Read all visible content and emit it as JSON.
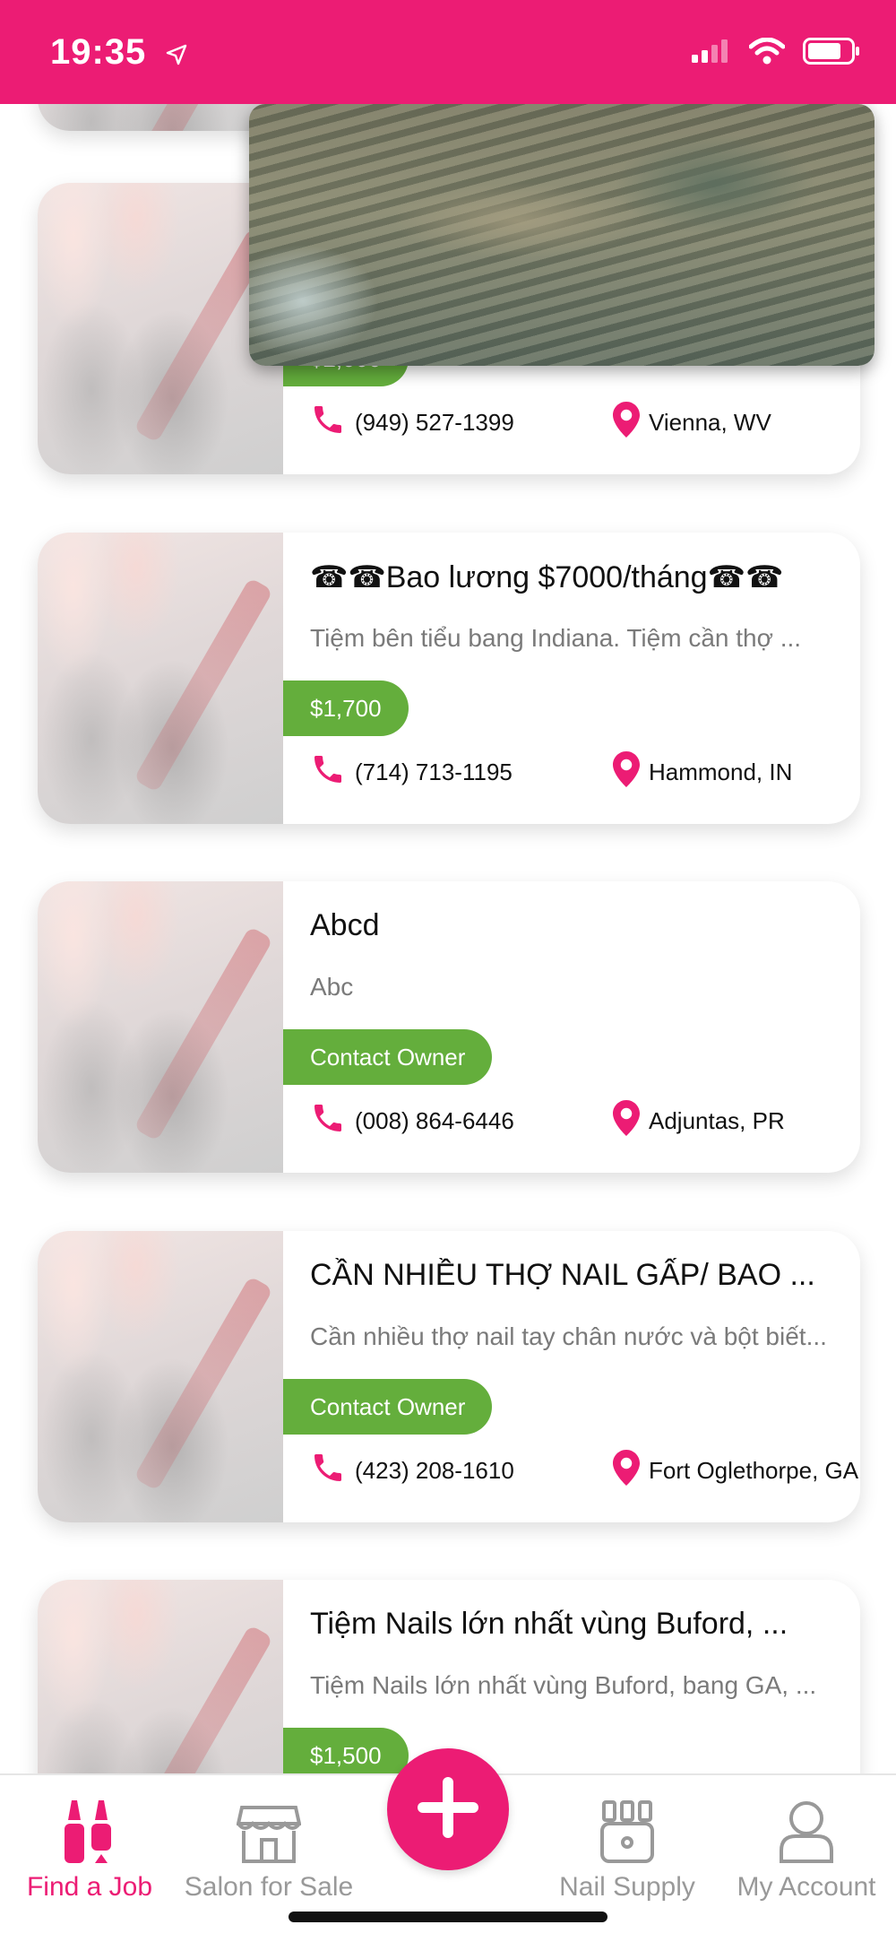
{
  "status_bar": {
    "time": "19:35"
  },
  "listings": [
    {
      "title": "",
      "description": "",
      "price": "$2,000",
      "phone": "(949) 527-1399",
      "location": "Vienna, WV"
    },
    {
      "title": "☎☎Bao lương $7000/tháng☎☎",
      "description": "Tiệm bên tiểu bang Indiana. Tiệm cần thợ ...",
      "price": "$1,700",
      "phone": "(714) 713-1195",
      "location": "Hammond, IN"
    },
    {
      "title": "Abcd",
      "description": "Abc",
      "price": "Contact Owner",
      "phone": "(008) 864-6446",
      "location": "Adjuntas, PR"
    },
    {
      "title": "CẦN NHIỀU THỢ NAIL GẤP/ BAO ...",
      "description": "Cần nhiều thợ nail tay chân nước và bột biết...",
      "price": "Contact Owner",
      "phone": "(423) 208-1610",
      "location": "Fort Oglethorpe, GA"
    },
    {
      "title": "Tiệm Nails lớn nhất vùng Buford, ...",
      "description": "Tiệm Nails lớn nhất vùng Buford, bang GA, ...",
      "price": "$1,500",
      "phone": "",
      "location": ""
    }
  ],
  "tabs": [
    {
      "label": "Find a Job",
      "icon": "nail-polish-icon",
      "active": true
    },
    {
      "label": "Salon for Sale",
      "icon": "storefront-icon",
      "active": false
    },
    {
      "label": "Nail Supply",
      "icon": "nail-supply-icon",
      "active": false
    },
    {
      "label": "My Account",
      "icon": "user-icon",
      "active": false
    }
  ],
  "colors": {
    "brand_pink": "#ec1c74",
    "price_green": "#64ae3c"
  }
}
